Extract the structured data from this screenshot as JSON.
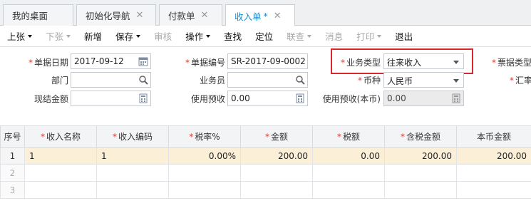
{
  "tabs": [
    {
      "label": "我的桌面",
      "closable": false
    },
    {
      "label": "初始化导航",
      "closable": true
    },
    {
      "label": "付款单",
      "closable": true
    },
    {
      "label": "收入单",
      "closable": true,
      "active": true,
      "modified_mark": "*"
    }
  ],
  "toolbar": {
    "items": [
      {
        "label": "上张",
        "dropdown": true,
        "enabled": true
      },
      {
        "label": "下张",
        "dropdown": true,
        "enabled": false
      },
      {
        "label": "新增",
        "dropdown": false,
        "enabled": true
      },
      {
        "label": "保存",
        "dropdown": true,
        "enabled": true
      },
      {
        "label": "审核",
        "dropdown": false,
        "enabled": false
      },
      {
        "label": "操作",
        "dropdown": true,
        "enabled": true
      },
      {
        "label": "查找",
        "dropdown": false,
        "enabled": true
      },
      {
        "label": "定位",
        "dropdown": false,
        "enabled": true
      },
      {
        "label": "联查",
        "dropdown": true,
        "enabled": false
      },
      {
        "label": "消息",
        "dropdown": false,
        "enabled": false
      },
      {
        "label": "打印",
        "dropdown": true,
        "enabled": false
      },
      {
        "label": "退出",
        "dropdown": false,
        "enabled": true
      }
    ]
  },
  "form": {
    "doc_date": {
      "label": "单据日期",
      "value": "2017-09-12"
    },
    "doc_no": {
      "label": "单据编号",
      "value": "SR-2017-09-0002"
    },
    "biz_type": {
      "label": "业务类型",
      "value": "往来收入"
    },
    "bill_type": {
      "label": "票据类型"
    },
    "dept": {
      "label": "部门",
      "value": ""
    },
    "salesman": {
      "label": "业务员",
      "value": ""
    },
    "currency": {
      "label": "币种",
      "value": "人民币"
    },
    "exchange": {
      "label": "汇率"
    },
    "cash_amount": {
      "label": "现结金额",
      "value": ""
    },
    "use_prepaid": {
      "label": "使用预收",
      "value": "0.00"
    },
    "use_prepaid_local": {
      "label": "使用预收(本币)",
      "value": "0.00"
    }
  },
  "grid": {
    "columns": [
      {
        "label": "序号",
        "required": false
      },
      {
        "label": "收入名称",
        "required": true
      },
      {
        "label": "收入编码",
        "required": true
      },
      {
        "label": "税率%",
        "required": true
      },
      {
        "label": "金额",
        "required": true
      },
      {
        "label": "税额",
        "required": true
      },
      {
        "label": "含税金额",
        "required": true
      },
      {
        "label": "本币金额",
        "required": false
      }
    ],
    "rows": [
      [
        "1",
        "1",
        "1",
        "0.00%",
        "200.00",
        "0.00",
        "200.00",
        "200.00"
      ],
      [
        "2",
        "",
        "",
        "",
        "",
        "",
        "",
        ""
      ],
      [
        "3",
        "",
        "",
        "",
        "",
        "",
        "",
        ""
      ]
    ]
  },
  "colors": {
    "accent": "#1d8acb",
    "required": "#e03c31",
    "highlight_border": "#d9262c",
    "selected_row": "#fcefd8"
  }
}
